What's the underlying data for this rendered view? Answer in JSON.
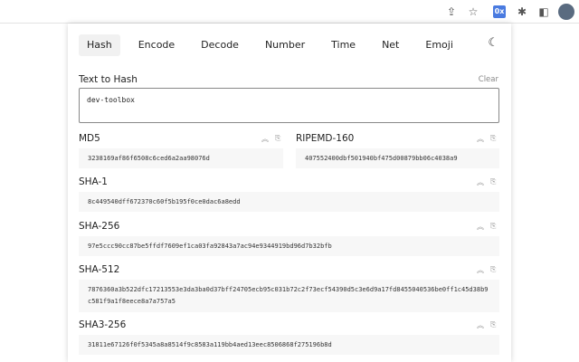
{
  "nav": {
    "tabs": [
      "Hash",
      "Encode",
      "Decode",
      "Number",
      "Time",
      "Net",
      "Emoji"
    ],
    "active": "Hash"
  },
  "toolbar": {
    "extension_label": "0x"
  },
  "input": {
    "label": "Text to Hash",
    "clear": "Clear",
    "value": "dev-toolbox"
  },
  "hashes": [
    {
      "name": "MD5",
      "value": "3238169af86f6508c6ced6a2aa98076d"
    },
    {
      "name": "RIPEMD-160",
      "value": "407552400dbf501940bf475d00879bb06c4038a9"
    },
    {
      "name": "SHA-1",
      "value": "8c449540dff672370c60f5b195f0ce0dac6a8edd"
    },
    {
      "name": "SHA-256",
      "value": "97e5ccc90cc87be5ffdf7609ef1ca03fa92843a7ac94e9344919bd96d7b32bfb"
    },
    {
      "name": "SHA-512",
      "value": "7876360a3b522dfc17213553e3da3ba0d37bff24705ecb95c031b72c2f73ecf54390d5c3e6d9a17fd8455040536be0ff1c45d38b9c581f9a1f8eece8a7a757a5"
    },
    {
      "name": "SHA3-256",
      "value": "31811e67126f0f5345a8a8514f9c8583a119bb4aed13eec8506868f275196b8d"
    }
  ]
}
